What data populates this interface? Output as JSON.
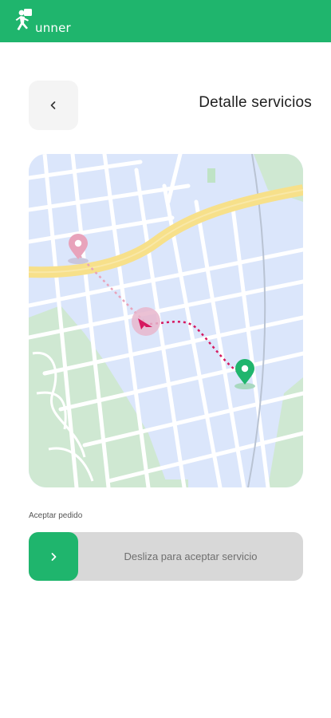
{
  "app": {
    "logo_text": "unner",
    "brand_color": "#1fb56d"
  },
  "header": {
    "title": "Detalle servicios",
    "back_icon": "chevron-left-icon"
  },
  "map": {
    "origin_icon": "map-pin-icon",
    "destination_icon": "map-pin-icon",
    "courier_icon": "navigation-arrow-icon",
    "origin_color": "#e8a3bb",
    "destination_color": "#1fb56d",
    "route_color": "#d6185f"
  },
  "accept": {
    "label": "Aceptar pedido",
    "slider_text": "Desliza para aceptar servicio",
    "knob_icon": "chevron-right-icon"
  }
}
